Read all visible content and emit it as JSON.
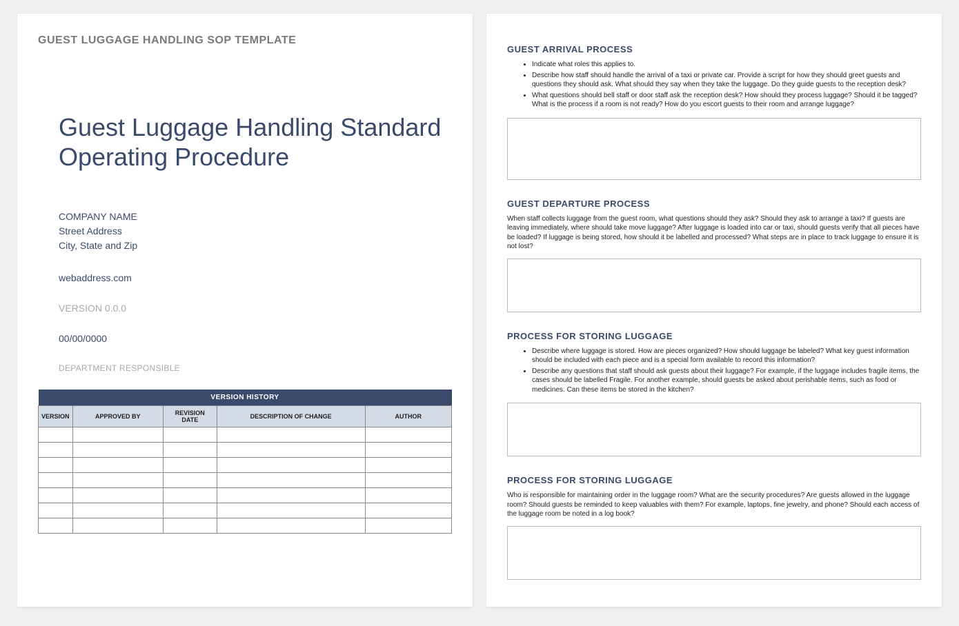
{
  "template_label": "GUEST LUGGAGE HANDLING SOP TEMPLATE",
  "main_title": "Guest Luggage Handling Standard Operating Procedure",
  "company": {
    "name": "COMPANY NAME",
    "street": "Street Address",
    "city_state_zip": "City, State and Zip"
  },
  "web_address": "webaddress.com",
  "version_label": "VERSION 0.0.0",
  "date_label": "00/00/0000",
  "department_label": "DEPARTMENT RESPONSIBLE",
  "version_table": {
    "title": "VERSION HISTORY",
    "columns": [
      "VERSION",
      "APPROVED BY",
      "REVISION DATE",
      "DESCRIPTION OF CHANGE",
      "AUTHOR"
    ],
    "row_count": 7
  },
  "sections": [
    {
      "heading": "GUEST ARRIVAL PROCESS",
      "bullets": [
        "Indicate what roles this applies to.",
        "Describe how staff should handle the arrival of a taxi or private car. Provide a script for how they should greet guests and questions they should ask. What should they say when they take the luggage. Do they guide guests to the reception desk?",
        "What questions should bell staff or door staff ask the reception desk? How should they process luggage? Should it be tagged? What is the process if a room is not ready? How do you escort guests to their room and arrange luggage?"
      ]
    },
    {
      "heading": "GUEST DEPARTURE PROCESS",
      "paragraph": "When staff collects luggage from the guest room, what questions should they ask? Should they ask to arrange a taxi? If guests are leaving immediately, where should take move luggage? After luggage is loaded into car or taxi, should guests verify that all pieces have be loaded? If luggage is being stored, how should it be labelled and processed? What steps are in place to track luggage to ensure it is not lost?"
    },
    {
      "heading": "PROCESS FOR STORING LUGGAGE",
      "bullets": [
        "Describe where luggage is stored. How are pieces organized? How should luggage be labeled? What key guest information should be included with each piece and is a special form available to record this information?",
        "Describe any questions that staff should ask guests about their luggage? For example, if the luggage includes fragile items, the cases should be labelled Fragile. For another example, should guests be asked about perishable items, such as food or medicines. Can these items be stored in the kitchen?"
      ]
    },
    {
      "heading": "PROCESS FOR STORING LUGGAGE",
      "paragraph": "Who is responsible for maintaining order in the luggage room? What are the security procedures? Are guests allowed in the luggage room? Should guests be reminded to keep valuables with them? For example, laptops, fine jewelry, and phone? Should each access of the luggage room be noted in a log book?"
    }
  ]
}
